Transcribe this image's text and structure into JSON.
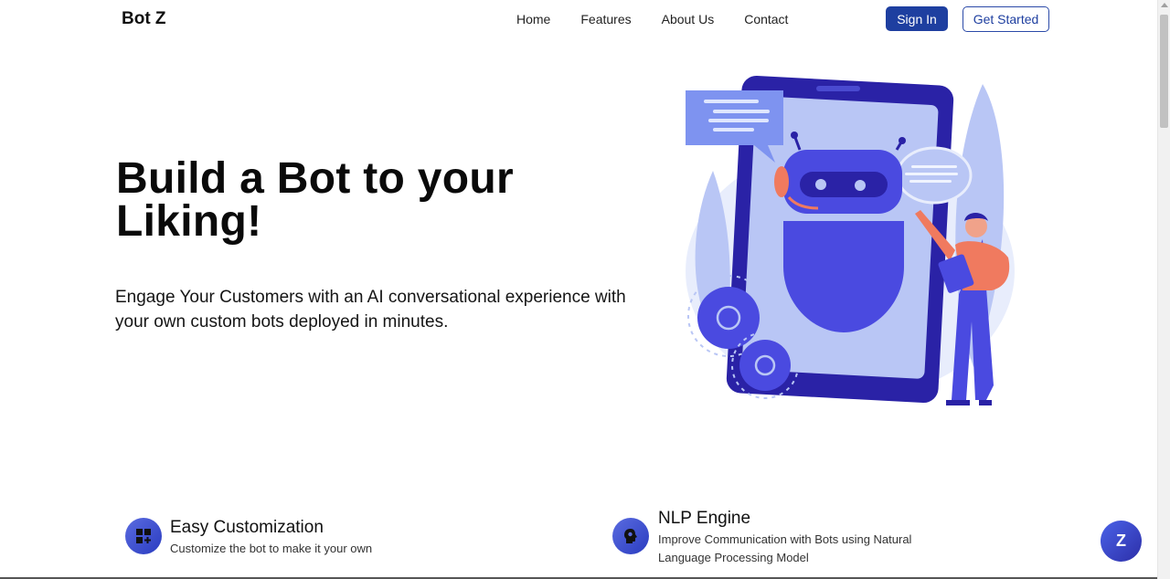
{
  "nav": {
    "brand": "Bot Z",
    "links": [
      "Home",
      "Features",
      "About Us",
      "Contact"
    ],
    "sign_in": "Sign In",
    "get_started": "Get Started"
  },
  "hero": {
    "title": "Build a Bot to your Liking!",
    "subtitle": "Engage Your Customers with an AI conversational experience with your own custom bots deployed in minutes."
  },
  "features": [
    {
      "title": "Easy Customization",
      "desc": "Customize the bot to make it your own",
      "icon": "dashboard-plus-icon"
    },
    {
      "title": "NLP Engine",
      "desc": "Improve Communication with Bots using Natural Language Processing Model",
      "icon": "brain-head-icon"
    }
  ],
  "floating": {
    "label": "Z"
  },
  "colors": {
    "primary": "#1e3fa0",
    "accent_blue": "#3b45d6",
    "art_light": "#b9c6f5",
    "art_dark": "#2a2aa0",
    "person_shirt": "#f07a5f"
  }
}
